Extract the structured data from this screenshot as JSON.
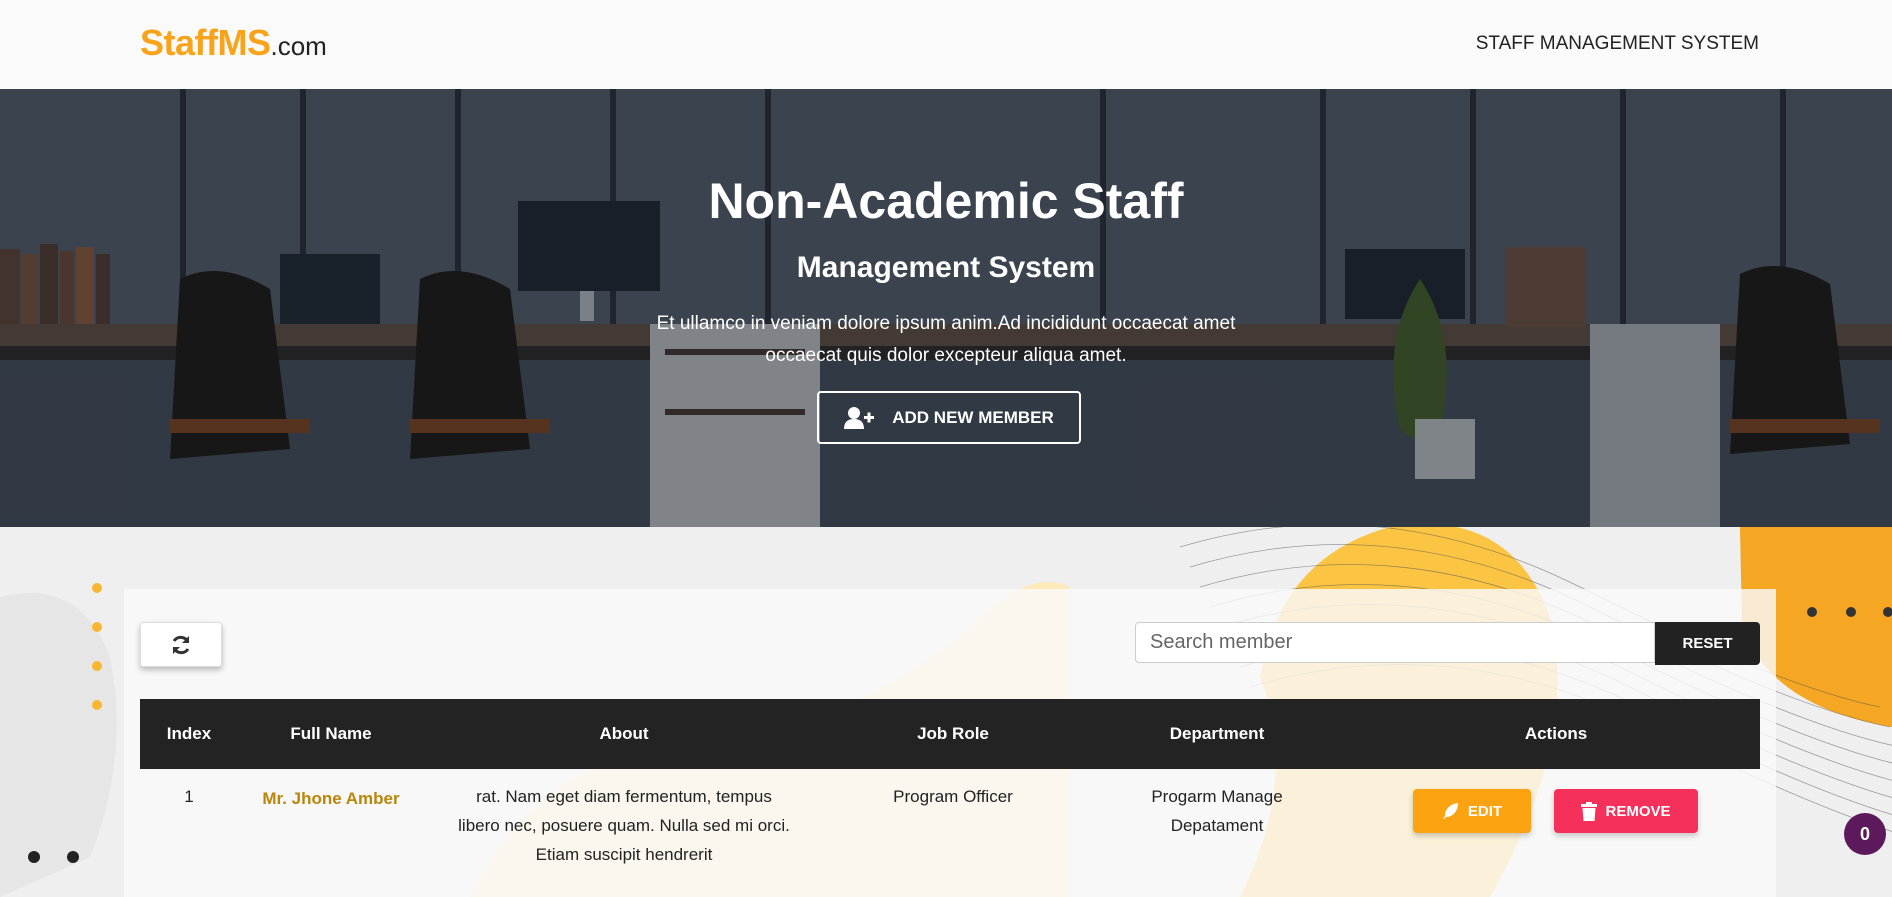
{
  "navbar": {
    "brand_main": "StaffMS",
    "brand_tld": ".com",
    "title": "STAFF MANAGEMENT SYSTEM"
  },
  "hero": {
    "title": "Non-Academic Staff",
    "subtitle": "Management System",
    "desc_line1": "Et ullamco in veniam dolore ipsum anim.Ad incididunt occaecat amet",
    "desc_line2": "occaecat quis dolor excepteur aliqua amet.",
    "add_button_label": "ADD NEW MEMBER"
  },
  "toolbar": {
    "search_placeholder": "Search member",
    "search_value": "",
    "reset_label": "RESET"
  },
  "table": {
    "columns": [
      "Index",
      "Full Name",
      "About",
      "Job Role",
      "Department",
      "Actions"
    ],
    "rows": [
      {
        "index": "1",
        "name": "Mr. Jhone Amber",
        "about_line1": "rat. Nam eget diam fermentum, tempus",
        "about_line2": "libero nec, posuere quam. Nulla sed mi orci.",
        "about_line3": "Etiam suscipit hendrerit",
        "job_role": "Program Officer",
        "department_line1": "Progarm Manage",
        "department_line2": "Depatament",
        "edit_label": "EDIT",
        "remove_label": "REMOVE"
      }
    ]
  },
  "badge": {
    "count": "0"
  },
  "colors": {
    "brand": "#f9a31a",
    "edit": "#fca311",
    "remove": "#f5305a",
    "table_header": "#232323",
    "badge": "#5c1a5c"
  }
}
